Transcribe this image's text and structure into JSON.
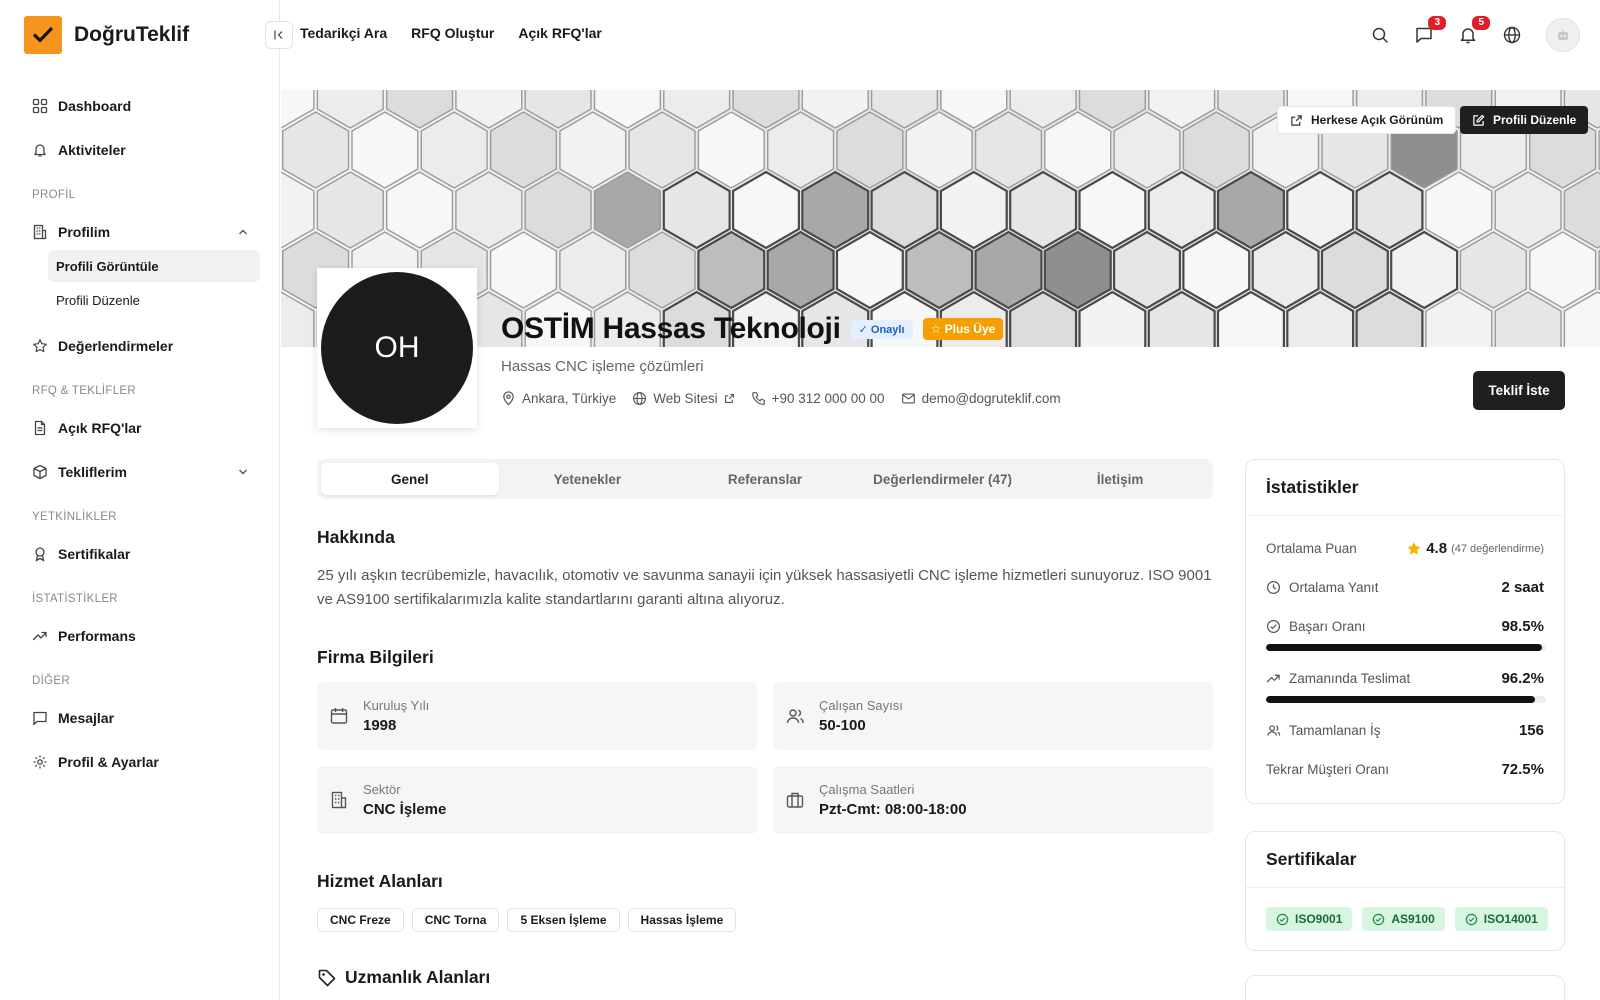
{
  "brand": {
    "name": "DoğruTeklif"
  },
  "sidebar": {
    "dashboard": "Dashboard",
    "aktiviteler": "Aktiviteler",
    "sec_profil": "PROFİL",
    "profilim": "Profilim",
    "profili_goruntule": "Profili Görüntüle",
    "profili_duzenle": "Profili Düzenle",
    "degerlendirmeler": "Değerlendirmeler",
    "sec_rfq": "RFQ & TEKLİFLER",
    "acik_rfq": "Açık RFQ'lar",
    "tekliflerim": "Tekliflerim",
    "sec_yetkinlik": "YETKİNLİKLER",
    "sertifikalar": "Sertifikalar",
    "sec_istatistik": "İSTATİSTİKLER",
    "performans": "Performans",
    "sec_diger": "DİĞER",
    "mesajlar": "Mesajlar",
    "profil_ayarlar": "Profil & Ayarlar"
  },
  "topnav": {
    "tedarikci": "Tedarikçi Ara",
    "rfq_olustur": "RFQ Oluştur",
    "acik_rfq": "Açık RFQ'lar"
  },
  "top": {
    "messages_count": "3",
    "notifications_count": "5"
  },
  "cover": {
    "public_view": "Herkese Açık Görünüm",
    "edit_profile": "Profili Düzenle"
  },
  "profile": {
    "initials": "OH",
    "company": "OSTİM Hassas Teknoloji",
    "verified": "✓ Onaylı",
    "plus": "☆ Plus Üye",
    "tagline": "Hassas CNC işleme çözümleri",
    "location": "Ankara, Türkiye",
    "website": "Web Sitesi",
    "phone": "+90 312 000 00 00",
    "email": "demo@dogruteklif.com",
    "offer_button": "Teklif İste"
  },
  "tabs": [
    "Genel",
    "Yetenekler",
    "Referanslar",
    "Değerlendirmeler (47)",
    "İletişim"
  ],
  "about": {
    "title": "Hakkında",
    "text": "25 yılı aşkın tecrübemizle, havacılık, otomotiv ve savunma sanayii için yüksek hassasiyetli CNC işleme hizmetleri sunuyoruz. ISO 9001 ve AS9100 sertifikalarımızla kalite standartlarını garanti altına alıyoruz."
  },
  "firma": {
    "title": "Firma Bilgileri",
    "kurulus_label": "Kuruluş Yılı",
    "kurulus_value": "1998",
    "calisan_label": "Çalışan Sayısı",
    "calisan_value": "50-100",
    "sektor_label": "Sektör",
    "sektor_value": "CNC İşleme",
    "saat_label": "Çalışma Saatleri",
    "saat_value": "Pzt-Cmt: 08:00-18:00"
  },
  "hizmet": {
    "title": "Hizmet Alanları",
    "tags": [
      "CNC Freze",
      "CNC Torna",
      "5 Eksen İşleme",
      "Hassas İşleme"
    ]
  },
  "uzmanlik": {
    "title": "Uzmanlık Alanları"
  },
  "stats": {
    "title": "İstatistikler",
    "rating_label": "Ortalama Puan",
    "rating_value": "4.8",
    "rating_count": "(47 değerlendirme)",
    "response_label": "Ortalama Yanıt",
    "response_value": "2 saat",
    "success_label": "Başarı Oranı",
    "success_value": "98.5%",
    "success_fill": 98.5,
    "ontime_label": "Zamanında Teslimat",
    "ontime_value": "96.2%",
    "ontime_fill": 96.2,
    "done_label": "Tamamlanan İş",
    "done_value": "156",
    "repeat_label": "Tekrar Müşteri Oranı",
    "repeat_value": "72.5%"
  },
  "certs": {
    "title": "Sertifikalar",
    "items": [
      "ISO9001",
      "AS9100",
      "ISO14001"
    ]
  },
  "colors": {
    "brand": "#f7941d",
    "verified_bg": "#e3efff",
    "plus_bg": "#f59f00",
    "cert_bg": "#d8f5e2",
    "badge": "#e11d2a"
  }
}
